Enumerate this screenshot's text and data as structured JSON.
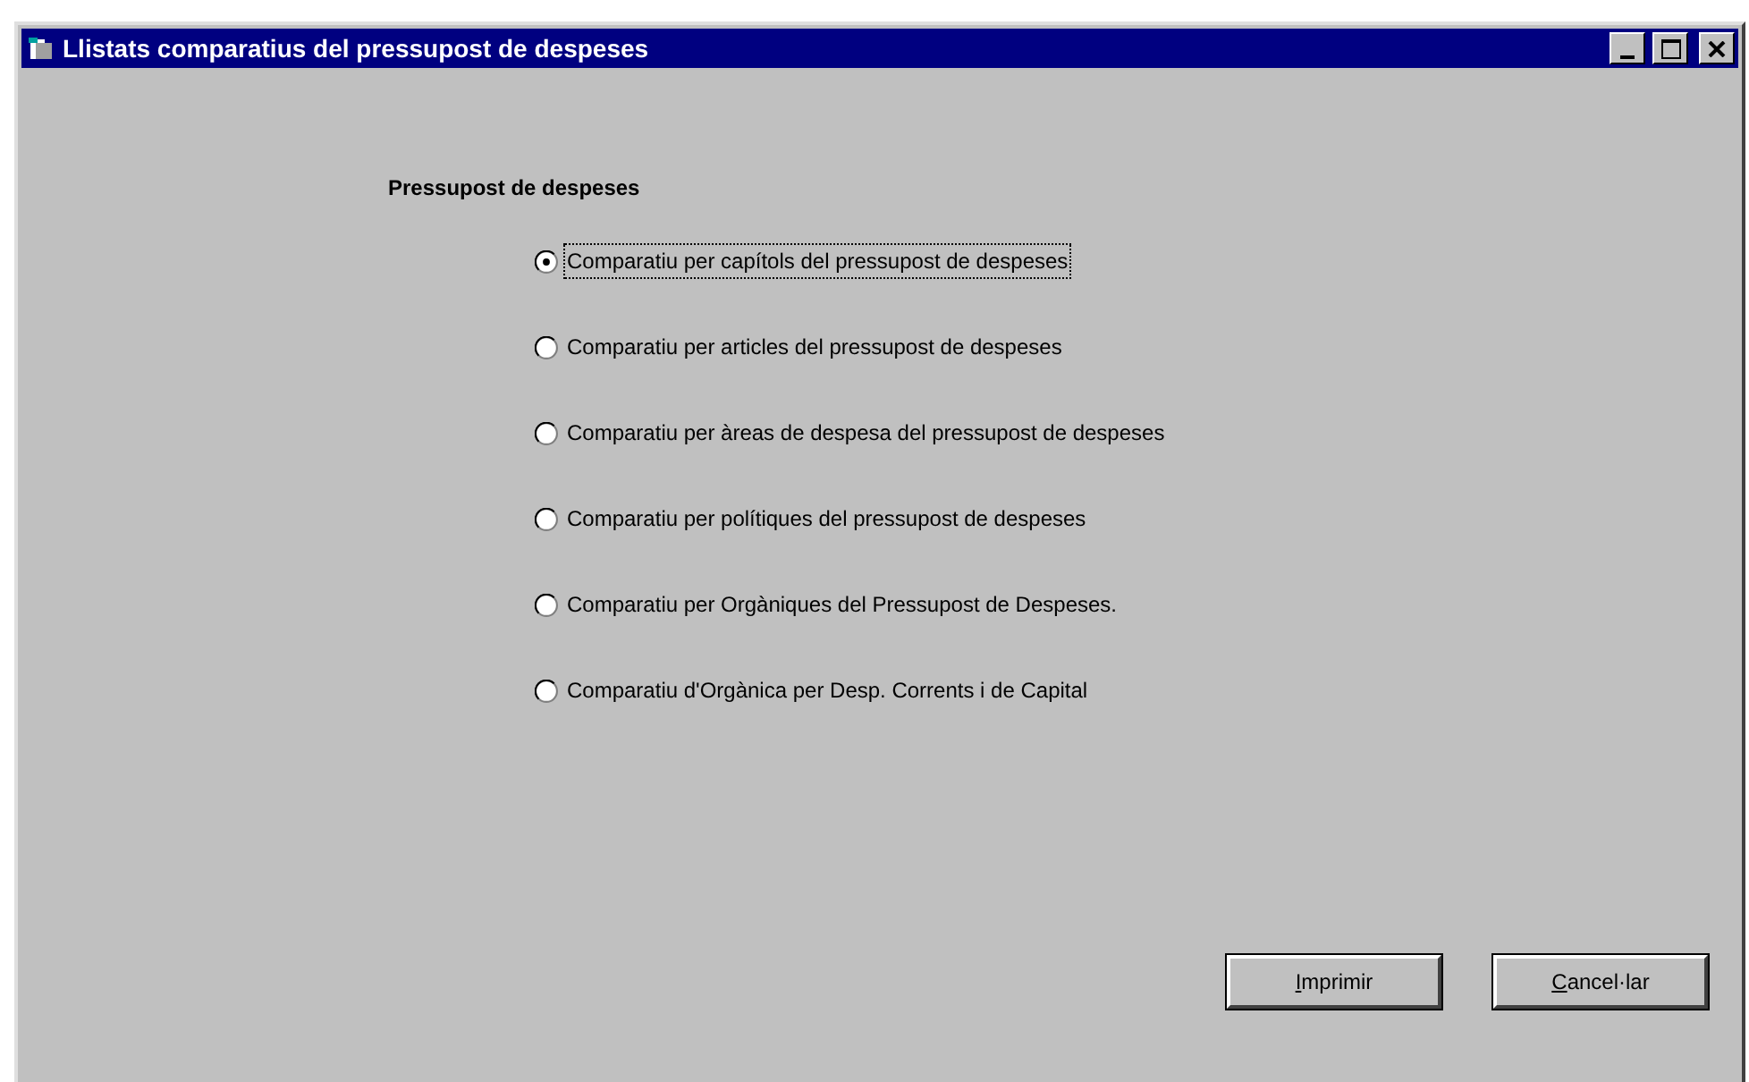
{
  "window": {
    "title": "Llistats comparatius del pressupost de despeses"
  },
  "group": {
    "title": "Pressupost de despeses"
  },
  "options": [
    {
      "label": "Comparatiu per capítols del pressupost de despeses",
      "selected": true
    },
    {
      "label": "Comparatiu per articles del pressupost de despeses",
      "selected": false
    },
    {
      "label": "Comparatiu per àreas de despesa del pressupost de despeses",
      "selected": false
    },
    {
      "label": "Comparatiu per polítiques del pressupost de despeses",
      "selected": false
    },
    {
      "label": "Comparatiu per Orgàniques del Pressupost de Despeses.",
      "selected": false
    },
    {
      "label": "Comparatiu d'Orgànica per Desp. Corrents i de Capital",
      "selected": false
    }
  ],
  "buttons": [
    {
      "label": "Imprimir"
    },
    {
      "label": "Cancel·lar"
    }
  ]
}
